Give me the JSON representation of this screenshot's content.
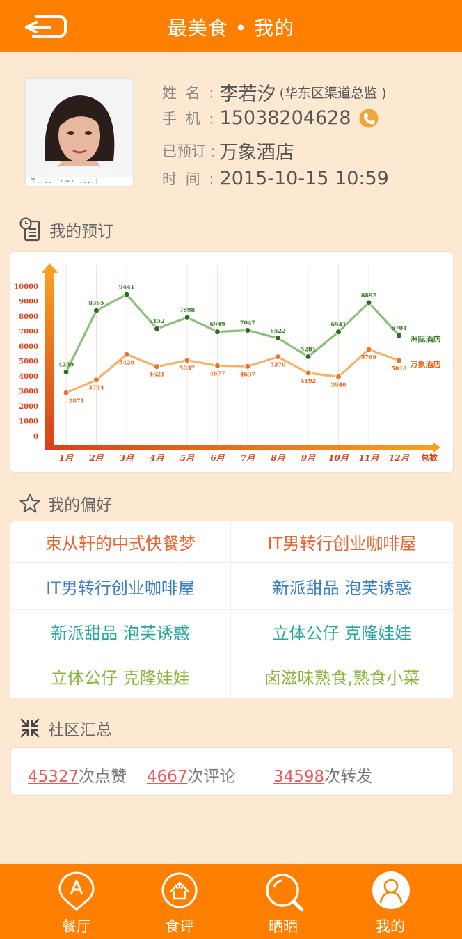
{
  "header": {
    "title": "最美食 • 我的"
  },
  "profile": {
    "name_label": "姓 名 :",
    "name": "李若汐",
    "title": "(华东区渠道总监 )",
    "phone_label": "手 机 :",
    "phone": "15038204628",
    "booked_label": "已预订 :",
    "booked": "万象酒店",
    "time_label": "时 间 :",
    "time": "2015-10-15 10:59"
  },
  "sections": {
    "bookings": "我的预订",
    "preferences": "我的偏好",
    "community": "社区汇总"
  },
  "chart_data": {
    "type": "line",
    "categories": [
      "1月",
      "2月",
      "3月",
      "4月",
      "5月",
      "6月",
      "7月",
      "8月",
      "9月",
      "10月",
      "11月",
      "12月"
    ],
    "xlabel": "总数",
    "ylim": [
      0,
      10000
    ],
    "yticks": [
      0,
      1000,
      2000,
      3000,
      4000,
      5000,
      6000,
      7000,
      8000,
      9000,
      10000
    ],
    "series": [
      {
        "name": "洲际酒店",
        "color": "#8cbf7d",
        "label_color": "#3a7a2a",
        "values": [
          4259,
          8365,
          9441,
          7152,
          7898,
          6949,
          7047,
          6522,
          5281,
          6941,
          8892,
          6704
        ]
      },
      {
        "name": "万象酒店",
        "color": "#f7b26a",
        "label_color": "#e06a1a",
        "values": [
          2871,
          3734,
          5429,
          4621,
          5037,
          4677,
          4637,
          5270,
          4192,
          3940,
          5769,
          5018
        ]
      }
    ]
  },
  "preferences": [
    {
      "label": "束从轩的中式快餐梦",
      "color": "#e8632e"
    },
    {
      "label": "IT男转行创业咖啡屋",
      "color": "#e8632e"
    },
    {
      "label": "IT男转行创业咖啡屋",
      "color": "#3b7fc0"
    },
    {
      "label": "新派甜品 泡芙诱惑",
      "color": "#3b7fc0"
    },
    {
      "label": "新派甜品 泡芙诱惑",
      "color": "#2aa5a0"
    },
    {
      "label": "立体公仔 克隆娃娃",
      "color": "#2aa5a0"
    },
    {
      "label": "立体公仔 克隆娃娃",
      "color": "#8ab43a"
    },
    {
      "label": "卤滋味熟食,熟食小菜",
      "color": "#8ab43a"
    }
  ],
  "stats": {
    "likes": "45327",
    "likes_label": "次点赞",
    "comments": "4667",
    "comments_label": "次评论",
    "shares": "34598",
    "shares_label": "次转发"
  },
  "tabs": [
    {
      "label": "餐厅",
      "icon": "restaurant-icon"
    },
    {
      "label": "食评",
      "icon": "review-icon"
    },
    {
      "label": "晒晒",
      "icon": "discover-icon"
    },
    {
      "label": "我的",
      "icon": "profile-icon"
    }
  ],
  "colors": {
    "brand": "#ff8000",
    "background": "#fde8d2",
    "accent_red": "#e85a5a"
  }
}
